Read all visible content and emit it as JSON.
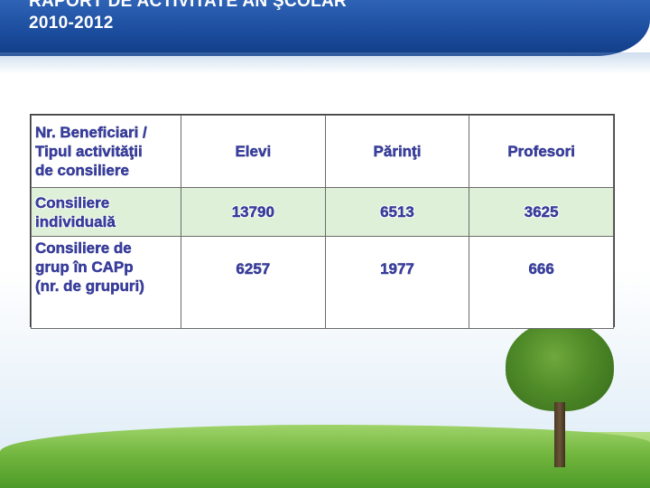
{
  "slide": {
    "title_line1": "RAPORT DE ACTIVITATE AN ŞCOLAR",
    "title_line2": "2010-2012"
  },
  "table": {
    "header": {
      "corner_lines": [
        "Nr. Beneficiari /",
        "Tipul activităţii",
        "de consiliere"
      ],
      "columns": [
        "Elevi",
        "Părinţi",
        "Profesori"
      ]
    },
    "rows": [
      {
        "label_lines": [
          "Consiliere",
          "individuală"
        ],
        "values": [
          "13790",
          "6513",
          "3625"
        ]
      },
      {
        "label_lines": [
          "Consiliere de",
          "grup în CAPp",
          "(nr. de grupuri)"
        ],
        "values": [
          "6257",
          "1977",
          "666"
        ]
      }
    ]
  },
  "colors": {
    "header_band": "#1c4d9e",
    "text": "#3a3f9b",
    "row_highlight": "#dff0d8"
  }
}
